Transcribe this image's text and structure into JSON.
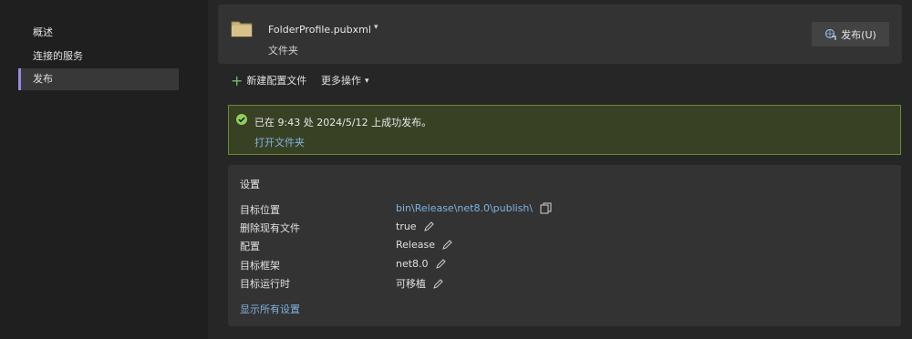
{
  "sidebar": {
    "items": [
      {
        "label": "概述",
        "active": false
      },
      {
        "label": "连接的服务",
        "active": false
      },
      {
        "label": "发布",
        "active": true
      }
    ]
  },
  "profile": {
    "name": "FolderProfile.pubxml",
    "type": "文件夹",
    "icon": "folder-icon",
    "publish_button": "发布(U)"
  },
  "toolbar": {
    "new_profile": "新建配置文件",
    "more_actions": "更多操作"
  },
  "status": {
    "message": "已在 9:43 处 2024/5/12 上成功发布。",
    "open_folder": "打开文件夹",
    "color": "#394125"
  },
  "settings": {
    "title": "设置",
    "rows": [
      {
        "label": "目标位置",
        "value": "bin\\Release\\net8.0\\publish\\"
      },
      {
        "label": "删除现有文件",
        "value": "true"
      },
      {
        "label": "配置",
        "value": "Release"
      },
      {
        "label": "目标框架",
        "value": "net8.0"
      },
      {
        "label": "目标运行时",
        "value": "可移植"
      }
    ],
    "show_all": "显示所有设置"
  },
  "colors": {
    "accent": "#9a86e6",
    "link": "#7fb3e0",
    "success_border": "#6a8a2e"
  }
}
